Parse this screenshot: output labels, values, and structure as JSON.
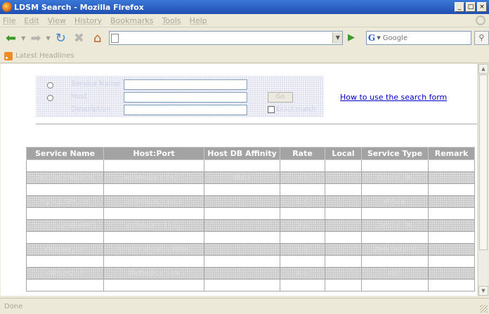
{
  "window": {
    "title": "LDSM Search - Mozilla Firefox",
    "buttons": {
      "minimize": "_",
      "maximize": "□",
      "close": "×"
    }
  },
  "menu": {
    "items": [
      "File",
      "Edit",
      "View",
      "History",
      "Bookmarks",
      "Tools",
      "Help"
    ]
  },
  "navigation": {
    "url": "",
    "search_engine": "G",
    "search_placeholder": "Google"
  },
  "bookmarks_toolbar": {
    "items": [
      "Latest Headlines"
    ]
  },
  "search_form": {
    "row1_label": "Service Name",
    "row2_label": "Host",
    "row3_label": "Description",
    "button_label": "Go",
    "checkbox_label": "Exact match",
    "help_link": "How to use the search form"
  },
  "results_table": {
    "headers": [
      "Service Name",
      "Host:Port",
      "Host DB Affinity",
      "Rate",
      "Local",
      "Service Type",
      "Remark"
    ],
    "column_widths": [
      110,
      143,
      108,
      64,
      52,
      95,
      66
    ],
    "rows": [
      {
        "style": "plain",
        "cells": [
          "",
          "",
          "",
          "",
          "",
          "",
          ""
        ]
      },
      {
        "style": "shaded",
        "cells": [
          "OracleServiceDB",
          "webhost01:1521",
          "db01",
          "1.0",
          "",
          "Oracle DB",
          ""
        ]
      },
      {
        "style": "plain",
        "cells": [
          "",
          "",
          "",
          "",
          "",
          "",
          ""
        ]
      },
      {
        "style": "shaded",
        "cells": [
          "MySQLService",
          "apphost02:3306",
          "",
          "0.5",
          "",
          "MySQL",
          ""
        ]
      },
      {
        "style": "plain",
        "cells": [
          "",
          "",
          "",
          "",
          "",
          "",
          ""
        ]
      },
      {
        "style": "shaded",
        "cells": [
          "OracleServiceRPT",
          "rpthost03:1521",
          "",
          "2.0",
          "",
          "Oracle DB",
          ""
        ]
      },
      {
        "style": "plain",
        "cells": [
          "",
          "",
          "",
          "",
          "",
          "",
          ""
        ]
      },
      {
        "style": "shaded",
        "cells": [
          "WebService",
          "serviceshost04:8080",
          "",
          "1.0",
          "",
          "Web Service",
          ""
        ]
      },
      {
        "style": "plain",
        "cells": [
          "",
          "",
          "",
          "",
          "",
          "",
          ""
        ]
      },
      {
        "style": "shaded",
        "cells": [
          "FileService",
          "filehost05:445",
          "",
          "0.8",
          "",
          "File",
          ""
        ]
      },
      {
        "style": "plain",
        "cells": [
          "",
          "",
          "",
          "",
          "",
          "",
          ""
        ]
      }
    ]
  },
  "status": {
    "text": "Done"
  }
}
